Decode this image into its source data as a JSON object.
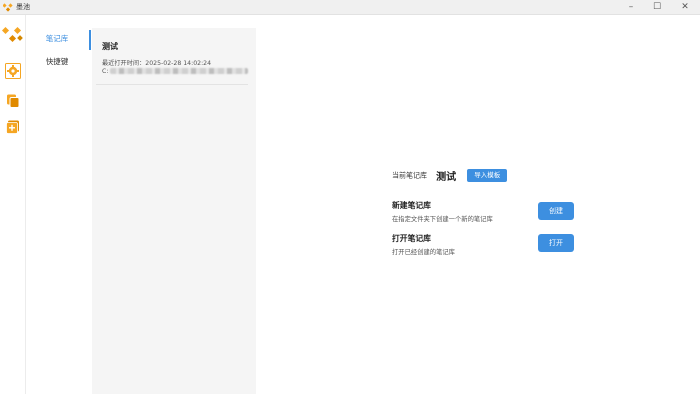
{
  "window": {
    "title": "墨池",
    "controls": {
      "minimize": "–",
      "maximize": "☐",
      "close": "✕"
    }
  },
  "rail": {
    "items": [
      {
        "icon": "logo-icon"
      },
      {
        "icon": "settings-icon",
        "active": true
      },
      {
        "icon": "copy-icon"
      },
      {
        "icon": "add-icon"
      }
    ]
  },
  "subnav": {
    "items": [
      {
        "label": "笔记库",
        "active": true
      },
      {
        "label": "快捷键",
        "active": false
      }
    ]
  },
  "vault_list": [
    {
      "name": "测试",
      "last_opened": "最近打开时间：2025-02-28 14:02:24",
      "path_prefix": "C:"
    }
  ],
  "current_vault": {
    "label": "当前笔记库",
    "name": "测试",
    "import_button": "导入模板"
  },
  "create_section": {
    "title": "新建笔记库",
    "desc": "在指定文件夹下创建一个新的笔记库",
    "button": "创建"
  },
  "open_section": {
    "title": "打开笔记库",
    "desc": "打开已经创建的笔记库",
    "button": "打开"
  },
  "colors": {
    "accent": "#3d8fe0",
    "brand_orange": "#f5a623",
    "panel_bg": "#f5f5f5"
  }
}
